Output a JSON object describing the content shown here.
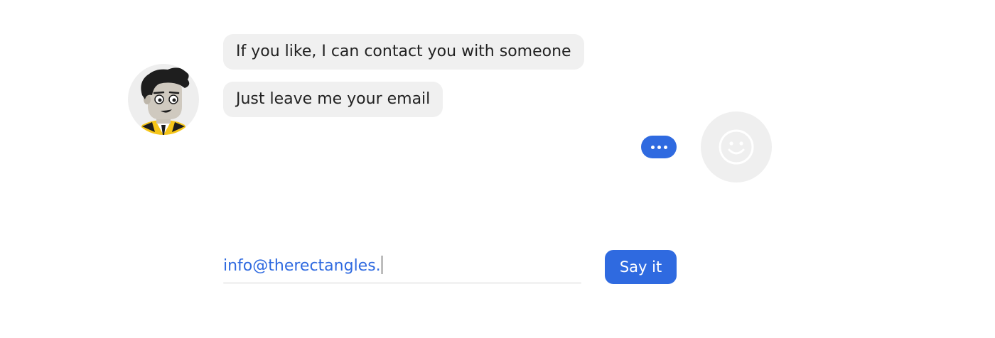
{
  "chat": {
    "bot_avatar_icon": "cartoon-man-avatar-icon",
    "messages": [
      {
        "sender": "bot",
        "text": "If you like, I can contact you with someone"
      },
      {
        "sender": "bot",
        "text": "Just leave me your email"
      }
    ],
    "typing_indicator": "•••",
    "user_avatar_icon": "smiley-face-icon"
  },
  "input": {
    "email_value": "info@therectangles.",
    "submit_label": "Say it"
  },
  "colors": {
    "accent": "#2f6ae0",
    "bubble_bg": "#f0f0f0",
    "avatar_bg": "#eeeeee",
    "text": "#222222",
    "avatar_yellow": "#f5c518",
    "avatar_hair": "#1e1e1e"
  }
}
